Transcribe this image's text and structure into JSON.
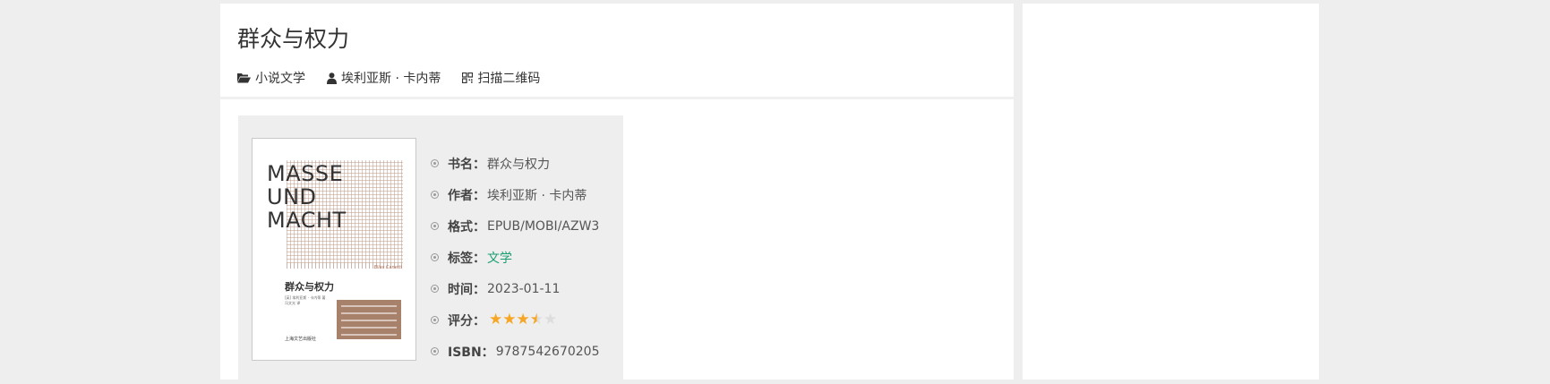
{
  "page": {
    "title": "群众与权力",
    "meta": {
      "category": "小说文学",
      "author": "埃利亚斯 · 卡内蒂",
      "qrcode": "扫描二维码"
    }
  },
  "cover": {
    "title_words": [
      "MASSE",
      "UND",
      "MACHT"
    ],
    "signature": "Elias Canetti",
    "cn_title": "群众与权力",
    "author_line": "[英] 埃利亚斯 · 卡内蒂 著",
    "translator_line": "冯文光 译",
    "publisher": "上海文艺出版社"
  },
  "info": {
    "name_label": "书名：",
    "name_value": "群众与权力",
    "author_label": "作者：",
    "author_value": "埃利亚斯 · 卡内蒂",
    "format_label": "格式：",
    "format_value": "EPUB/MOBI/AZW3",
    "tag_label": "标签：",
    "tag_value": "文学",
    "date_label": "时间：",
    "date_value": "2023-01-11",
    "rating_label": "评分：",
    "rating": 3.5,
    "rating_max": 5,
    "isbn_label": "ISBN：",
    "isbn_value": "9787542670205"
  },
  "colors": {
    "star_on": "#f6a623",
    "star_off": "#dddddd",
    "tag_link": "#1a9e70"
  }
}
